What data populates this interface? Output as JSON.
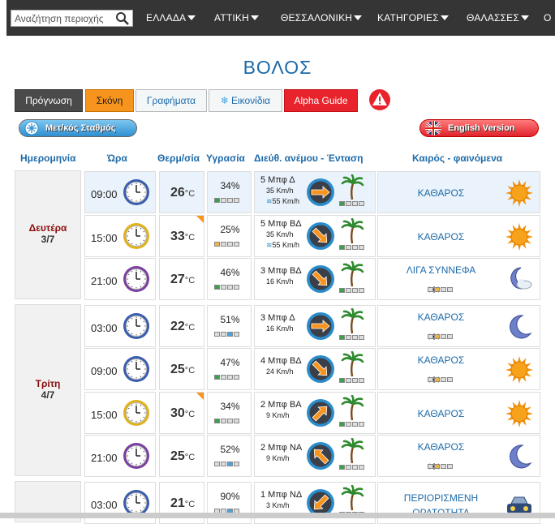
{
  "nav": {
    "search_placeholder": "Αναζήτηση περιοχής",
    "items": [
      "ΕΛΛΑΔΑ",
      "ΑΤΤΙΚΗ",
      "ΘΕΣΣΑΛΟΝΙΚΗ",
      "ΚΑΤΗΓΟΡΙΕΣ",
      "ΘΑΛΑΣΣΕΣ",
      "Ο"
    ]
  },
  "title": "ΒΟΛΟΣ",
  "tabs": {
    "forecast": "Πρόγνωση",
    "dust": "Σκόνη",
    "graphs": "Γραφήματα",
    "images": "Εικονίδια",
    "alpha": "Alpha Guide"
  },
  "buttons": {
    "station": "Μετ/κός Σταθμός",
    "english": "English Version"
  },
  "headers": {
    "date": "Ημερομηνία",
    "time": "Ώρα",
    "temp": "Θερμ/σία",
    "hum": "Υγρασία",
    "wind": "Διεύθ. ανέμου - Ένταση",
    "weather": "Καιρός - φαινόμενα"
  },
  "unit": "°C",
  "days": [
    {
      "name": "Δευτέρα",
      "date": "3/7",
      "rows": [
        {
          "time": "09:00",
          "temp": "26",
          "hum": "34%",
          "wind": "5 Μπφ Δ",
          "speed": "35 Km/h",
          "gust": "55 Km/h",
          "wx": "ΚΑΘΑΡΟΣ",
          "icon": "sun",
          "clock": "blue",
          "hot": false,
          "hl": true,
          "mosq": false
        },
        {
          "time": "15:00",
          "temp": "33",
          "hum": "25%",
          "wind": "5 Μπφ ΒΔ",
          "speed": "35 Km/h",
          "gust": "55 Km/h",
          "wx": "ΚΑΘΑΡΟΣ",
          "icon": "sun",
          "clock": "yellow",
          "hot": true,
          "hl": false,
          "mosq": false
        },
        {
          "time": "21:00",
          "temp": "27",
          "hum": "46%",
          "wind": "3 Μπφ ΒΔ",
          "speed": "16 Km/h",
          "gust": "",
          "wx": "ΛΙΓΑ ΣΥΝΝΕΦΑ",
          "icon": "moon-cloud",
          "clock": "purple",
          "hot": false,
          "hl": false,
          "mosq": true
        }
      ]
    },
    {
      "name": "Τρίτη",
      "date": "4/7",
      "rows": [
        {
          "time": "03:00",
          "temp": "22",
          "hum": "51%",
          "wind": "3 Μπφ Δ",
          "speed": "16 Km/h",
          "gust": "",
          "wx": "ΚΑΘΑΡΟΣ",
          "icon": "moon",
          "clock": "blue",
          "hot": false,
          "hl": false,
          "mosq": true
        },
        {
          "time": "09:00",
          "temp": "25",
          "hum": "47%",
          "wind": "4 Μπφ ΒΔ",
          "speed": "24 Km/h",
          "gust": "",
          "wx": "ΚΑΘΑΡΟΣ",
          "icon": "sun",
          "clock": "blue",
          "hot": false,
          "hl": false,
          "mosq": true
        },
        {
          "time": "15:00",
          "temp": "30",
          "hum": "34%",
          "wind": "2 Μπφ ΒΑ",
          "speed": "9 Km/h",
          "gust": "",
          "wx": "ΚΑΘΑΡΟΣ",
          "icon": "sun",
          "clock": "yellow",
          "hot": true,
          "hl": false,
          "mosq": false
        },
        {
          "time": "21:00",
          "temp": "25",
          "hum": "52%",
          "wind": "2 Μπφ ΝΑ",
          "speed": "9 Km/h",
          "gust": "",
          "wx": "ΚΑΘΑΡΟΣ",
          "icon": "moon",
          "clock": "purple",
          "hot": false,
          "hl": false,
          "mosq": true
        }
      ]
    },
    {
      "name": "",
      "date": "",
      "rows": [
        {
          "time": "03:00",
          "temp": "21",
          "hum": "90%",
          "wind": "1 Μπφ ΝΔ",
          "speed": "3 Km/h",
          "gust": "",
          "wx": "ΠΕΡΙΟΡΙΣΜΕΝΗ ΟΡΑΤΟΤΗΤΑ",
          "icon": "car",
          "clock": "blue",
          "hot": false,
          "hl": false,
          "mosq": false
        }
      ]
    }
  ],
  "colors": {
    "accent": "#1c6aa9",
    "dust": "#f7941d",
    "alpha": "#e8232b",
    "dayname": "#8a0d0d"
  }
}
